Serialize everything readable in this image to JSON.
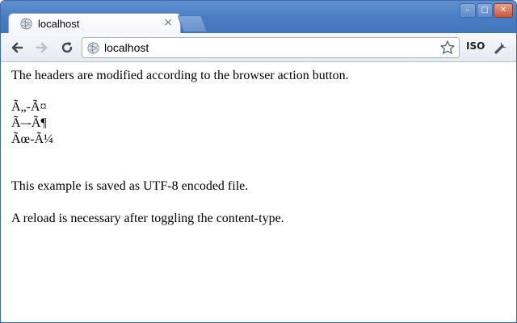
{
  "window": {
    "controls": {
      "minimize": "–",
      "maximize": "□",
      "close": "✕"
    }
  },
  "tab": {
    "title": "localhost",
    "favicon": "globe-icon",
    "close": "×"
  },
  "toolbar": {
    "address": "localhost",
    "page_icon": "globe-icon",
    "extension_label": "ISO",
    "icons": [
      "back-arrow-icon",
      "forward-arrow-icon",
      "reload-icon",
      "star-icon",
      "wrench-icon"
    ]
  },
  "page": {
    "intro": "The headers are modified according to the browser action button.",
    "garbled": [
      "Ã„-Ã¤",
      "Ã–-Ã¶",
      "Ãœ-Ã¼"
    ],
    "note_encoding": "This example is saved as UTF-8 encoded file.",
    "note_reload": "A reload is necessary after toggling the content-type."
  },
  "colors": {
    "titlebar": "#4a7ec4",
    "toolbar": "#eef2f7"
  }
}
